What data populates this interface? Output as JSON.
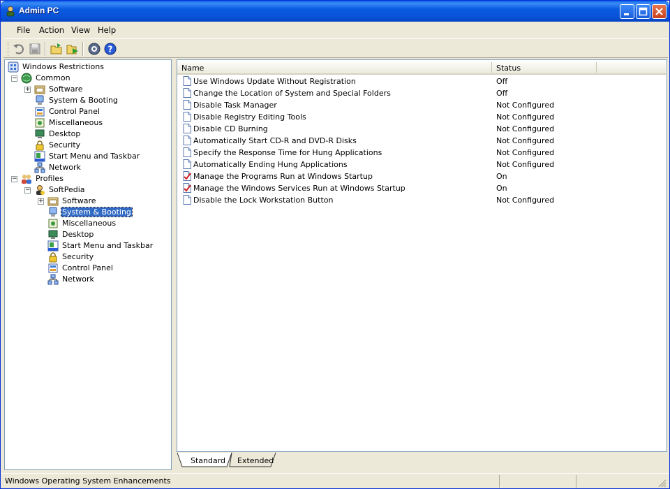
{
  "window": {
    "title": "Admin PC"
  },
  "menu": [
    "File",
    "Action",
    "View",
    "Help"
  ],
  "toolbar": [
    "undo-icon",
    "save-icon",
    "open-folder-icon",
    "export-icon",
    "settings-icon",
    "help-icon"
  ],
  "tree": {
    "root": "Windows Restrictions",
    "common": {
      "label": "Common",
      "items": [
        "Software",
        "System & Booting",
        "Control Panel",
        "Miscellaneous",
        "Desktop",
        "Security",
        "Start Menu and Taskbar",
        "Network"
      ]
    },
    "profiles": {
      "label": "Profiles",
      "profile": "SoftPedia",
      "items": [
        "Software",
        "System & Booting",
        "Miscellaneous",
        "Desktop",
        "Start Menu and Taskbar",
        "Security",
        "Control Panel",
        "Network"
      ],
      "selected": "System & Booting"
    }
  },
  "list": {
    "columns": [
      "Name",
      "Status"
    ],
    "rows": [
      {
        "name": "Use Windows Update Without Registration",
        "status": "Off",
        "checked": false
      },
      {
        "name": "Change the Location of System and Special Folders",
        "status": "Off",
        "checked": false
      },
      {
        "name": "Disable Task Manager",
        "status": "Not Configured",
        "checked": false
      },
      {
        "name": "Disable Registry Editing Tools",
        "status": "Not Configured",
        "checked": false
      },
      {
        "name": "Disable CD Burning",
        "status": "Not Configured",
        "checked": false
      },
      {
        "name": "Automatically Start CD-R and DVD-R Disks",
        "status": "Not Configured",
        "checked": false
      },
      {
        "name": "Specify the Response Time for Hung Applications",
        "status": "Not Configured",
        "checked": false
      },
      {
        "name": "Automatically Ending Hung Applications",
        "status": "Not Configured",
        "checked": false
      },
      {
        "name": "Manage the Programs Run at Windows Startup",
        "status": "On",
        "checked": true
      },
      {
        "name": "Manage the Windows Services Run at Windows Startup",
        "status": "On",
        "checked": true
      },
      {
        "name": "Disable the Lock Workstation Button",
        "status": "Not Configured",
        "checked": false
      }
    ]
  },
  "tabs": [
    "Standard",
    "Extended"
  ],
  "status": {
    "text": "Windows Operating System Enhancements"
  }
}
